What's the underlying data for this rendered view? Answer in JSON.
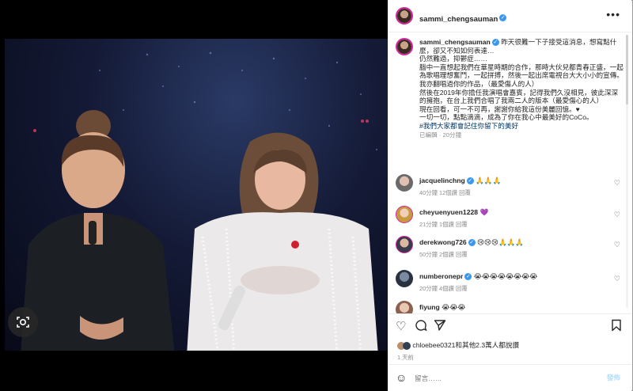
{
  "post": {
    "username": "sammi_chengsauman",
    "caption_lines": [
      "昨天很難一下子接受這消息，想寫點什麼，卻又不知如何表達…",
      "仍然難過，抑鬱症……",
      "腦中一直想起我們在華星時期的合作，那時大伙兒都青春正盛，一起為歌唱理想奮鬥，一起拼搏，然後一起出席電視台大大小小的宣傳。",
      "我亦翻唱過你的作品，（最愛傷人的人）",
      "然後在2019年你擔任我演唱會嘉賓，記得我們久沒相見，彼此深深的擁抱，在台上我們合唱了我兩二人的版本（最愛傷心的人）",
      "現在回看，可一不可再，謝謝你給我這份美麗回憶。♥",
      "一切一切，點點滴滴，成為了你在我心中最美好的CoCo。"
    ],
    "hashtag": "#我們大家都會記住你留下的美好",
    "edited_meta": "已編輯 · 20分鐘"
  },
  "comments": [
    {
      "user": "jacquelinchng",
      "verified": true,
      "text": "🙏🙏🙏",
      "meta": "40分鐘   12個讚   回覆"
    },
    {
      "user": "cheyuenyuen1228",
      "verified": false,
      "text": "💜",
      "meta": "21分鐘   1個讚   回覆"
    },
    {
      "user": "derekwong726",
      "verified": true,
      "text": "😢😢😢🙏🙏🙏",
      "meta": "50分鐘   2個讚   回覆"
    },
    {
      "user": "numberonepr",
      "verified": true,
      "text": "😭😭😭😭😭😭😭😭",
      "meta": "20分鐘   4個讚   回覆"
    },
    {
      "user": "fiyung",
      "verified": false,
      "text": "😭😭😭",
      "meta": ""
    }
  ],
  "likes_text": "chloebee0321和其他2.3萬人都說讚",
  "date_text": "1 天前",
  "add_comment_placeholder": "留言……",
  "post_label": "發佈",
  "icons": {
    "like": "heart-icon",
    "comment": "comment-icon",
    "share": "paper-plane-icon",
    "save": "bookmark-icon",
    "emoji": "emoji-icon",
    "more": "more-options-icon",
    "camera": "camera-search-icon"
  },
  "colors": {
    "verified": "#3897f0",
    "hashtag": "#00376b",
    "post_button": "#b2dffc"
  }
}
